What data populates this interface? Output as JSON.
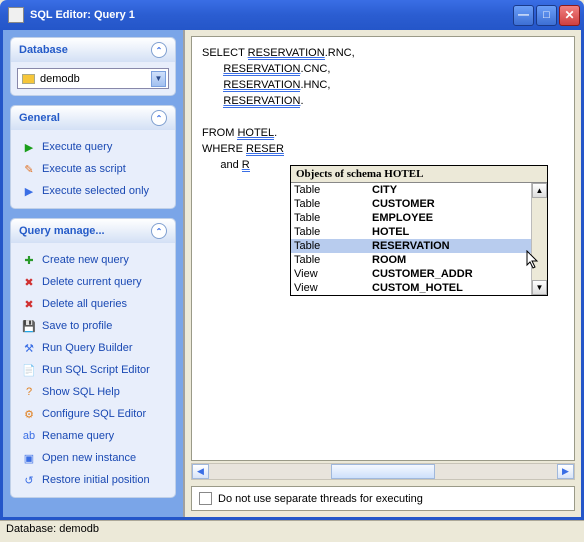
{
  "window": {
    "title": "SQL Editor: Query 1"
  },
  "sidebar": {
    "database": {
      "title": "Database",
      "value": "demodb"
    },
    "general": {
      "title": "General",
      "items": [
        {
          "icon": "▶",
          "color": "#1a9e1a",
          "label": "Execute query"
        },
        {
          "icon": "✎",
          "color": "#e07020",
          "label": "Execute as script"
        },
        {
          "icon": "▶",
          "color": "#3a6ee5",
          "label": "Execute selected only"
        }
      ]
    },
    "qm": {
      "title": "Query manage...",
      "items": [
        {
          "icon": "✚",
          "color": "#2a9a2a",
          "label": "Create new query"
        },
        {
          "icon": "✖",
          "color": "#d03030",
          "label": "Delete current query"
        },
        {
          "icon": "✖",
          "color": "#d03030",
          "label": "Delete all queries"
        },
        {
          "icon": "💾",
          "color": "#d0a030",
          "label": "Save to profile"
        },
        {
          "icon": "⚒",
          "color": "#3a6ee5",
          "label": "Run Query Builder"
        },
        {
          "icon": "📄",
          "color": "#3a6ee5",
          "label": "Run SQL Script Editor"
        },
        {
          "icon": "?",
          "color": "#e08020",
          "label": "Show SQL Help"
        },
        {
          "icon": "⚙",
          "color": "#e08020",
          "label": "Configure SQL Editor"
        },
        {
          "icon": "ab",
          "color": "#3a6ee5",
          "label": "Rename query"
        },
        {
          "icon": "▣",
          "color": "#3a6ee5",
          "label": "Open new instance"
        },
        {
          "icon": "↺",
          "color": "#3a6ee5",
          "label": "Restore initial position"
        }
      ]
    }
  },
  "editor": {
    "l1_kw": "SELECT ",
    "l1_tok": "RESERVATION",
    "l1_rest": ".RNC,",
    "l2_pad": "       ",
    "l2_tok": "RESERVATION",
    "l2_rest": ".CNC,",
    "l3_pad": "       ",
    "l3_tok": "RESERVATION",
    "l3_rest": ".HNC,",
    "l4_pad": "       ",
    "l4_tok": "RESERVATION",
    "l4_rest": ".",
    "l5_kw": "FROM ",
    "l5_tok": "HOTEL",
    "l5_rest": ".",
    "l6_kw": "WHERE ",
    "l6_tok": "RESER",
    "l7_pad": "      ",
    "l7_kw": "and ",
    "l7_tok": "R"
  },
  "popup": {
    "title": "Objects of schema HOTEL",
    "rows": [
      {
        "type": "Table",
        "name": "CITY",
        "sel": false
      },
      {
        "type": "Table",
        "name": "CUSTOMER",
        "sel": false
      },
      {
        "type": "Table",
        "name": "EMPLOYEE",
        "sel": false
      },
      {
        "type": "Table",
        "name": "HOTEL",
        "sel": false
      },
      {
        "type": "Table",
        "name": "RESERVATION",
        "sel": true
      },
      {
        "type": "Table",
        "name": "ROOM",
        "sel": false
      },
      {
        "type": "View",
        "name": "CUSTOMER_ADDR",
        "sel": false
      },
      {
        "type": "View",
        "name": "CUSTOM_HOTEL",
        "sel": false
      }
    ]
  },
  "checkbar": {
    "label": "Do not use separate threads for executing"
  },
  "status": {
    "text": "Database: demodb"
  }
}
